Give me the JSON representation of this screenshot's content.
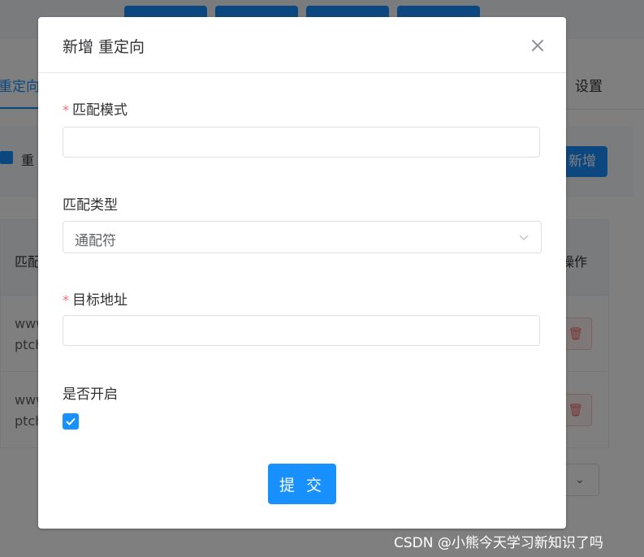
{
  "background": {
    "tabs": [
      {
        "label": "重定向"
      },
      {
        "label": "设置"
      }
    ],
    "filter_checkbox_label": "重",
    "add_button_label": "新增",
    "table": {
      "header_first": "匹配",
      "header_last": "操作",
      "rows": [
        {
          "line1": "www",
          "line2": "ptch"
        },
        {
          "line1": "www",
          "line2": "ptch"
        }
      ]
    }
  },
  "dialog": {
    "title": "新增 重定向",
    "close_icon": "close-icon",
    "fields": {
      "pattern": {
        "label": "匹配模式",
        "required": true,
        "value": "",
        "placeholder": ""
      },
      "match_type": {
        "label": "匹配类型",
        "value": "通配符"
      },
      "target": {
        "label": "目标地址",
        "required": true,
        "value": "",
        "placeholder": ""
      },
      "enabled": {
        "label": "是否开启",
        "checked": true
      }
    },
    "submit_label": "提 交"
  },
  "watermark": "CSDN @小熊今天学习新知识了吗",
  "colors": {
    "primary": "#1890ff",
    "required": "#f56c6c",
    "overlay": "rgba(0,0,0,0.5)"
  }
}
